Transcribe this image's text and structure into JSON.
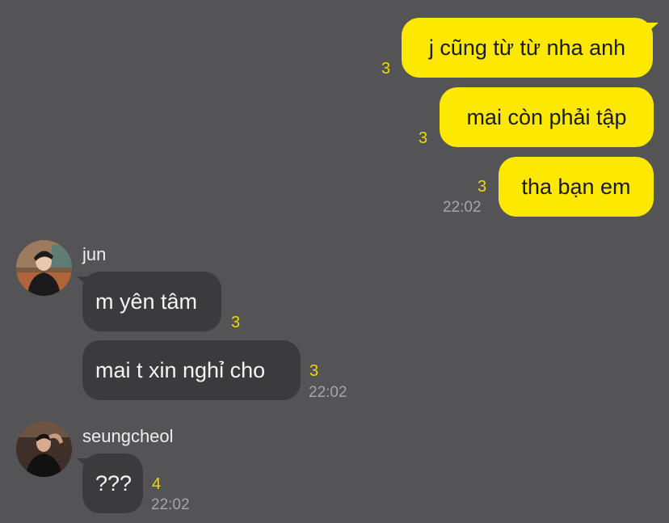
{
  "outgoing": [
    {
      "text": "j cũng từ từ nha anh",
      "unread": "3"
    },
    {
      "text": "mai còn phải tập",
      "unread": "3"
    },
    {
      "text": "tha bạn em",
      "unread": "3",
      "time": "22:02"
    }
  ],
  "groups": [
    {
      "sender": "jun",
      "messages": [
        {
          "text": "m yên tâm",
          "unread": "3"
        },
        {
          "text": "mai t xin nghỉ cho",
          "unread": "3",
          "time": "22:02"
        }
      ]
    },
    {
      "sender": "seungcheol",
      "messages": [
        {
          "text": "???",
          "unread": "4",
          "time": "22:02"
        }
      ]
    }
  ],
  "colors": {
    "background": "#545355",
    "outgoing_bubble": "#fce800",
    "incoming_bubble": "#3b3a3c",
    "unread_count": "#f1d800"
  }
}
